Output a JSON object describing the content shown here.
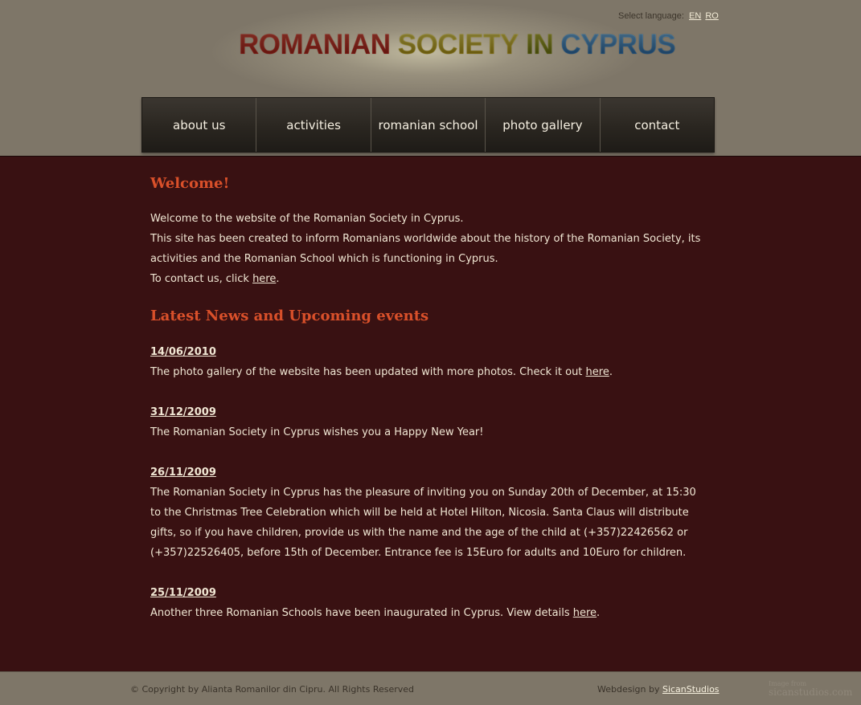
{
  "language": {
    "label": "Select language:",
    "options": [
      "EN",
      "RO"
    ]
  },
  "logo": {
    "words": [
      "ROMANIAN",
      "SOCIETY",
      "IN",
      "CYPRUS"
    ]
  },
  "nav": {
    "items": [
      "about us",
      "activities",
      "romanian school",
      "photo gallery",
      "contact"
    ]
  },
  "welcome": {
    "title": "Welcome!",
    "line1": "Welcome to the website of the Romanian Society in Cyprus.",
    "line2": "This site has been created to inform Romanians worldwide about the history of the Romanian Society, its activities and the Romanian School which is functioning in Cyprus.",
    "contact_prefix": "To contact us, click ",
    "contact_link": "here",
    "contact_suffix": "."
  },
  "news": {
    "title": "Latest News and Upcoming events",
    "items": [
      {
        "date": "14/06/2010",
        "text": "The photo gallery of the website has been updated with more photos. Check it out ",
        "link": "here",
        "suffix": "."
      },
      {
        "date": "31/12/2009",
        "text": "The Romanian Society in Cyprus wishes you a Happy New Year!"
      },
      {
        "date": "26/11/2009",
        "text": "The Romanian Society in Cyprus has the pleasure of inviting you on Sunday 20th of December, at 15:30 to the Christmas Tree Celebration which will be held at Hotel Hilton, Nicosia. Santa Claus will distribute gifts, so if you have children, provide us with the name and the age of the child at (+357)22426562 or (+357)22526405, before 15th of December. Entrance fee is 15Euro for adults and 10Euro for children."
      },
      {
        "date": "25/11/2009",
        "text": "Another three Romanian Schools have been inaugurated in Cyprus. View details ",
        "link": "here",
        "suffix": "."
      }
    ]
  },
  "footer": {
    "copyright": "© Copyright by Alianta Romanilor din Cipru. All Rights Reserved",
    "credit_prefix": "Webdesign by ",
    "credit_link": "SicanStudios",
    "watermark_line1": "Image from",
    "watermark_line2": "sicanstudios.com"
  },
  "colors": {
    "header_bg": "#7e7668",
    "content_bg": "#391112",
    "heading": "#d9502a",
    "text": "#f0e6d3",
    "nav_bg": "#2a2620"
  }
}
